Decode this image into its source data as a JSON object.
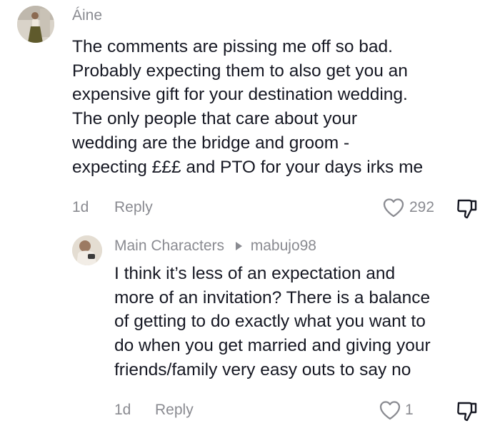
{
  "comment": {
    "username": "Áine",
    "avatar_icon": "user-avatar-photo",
    "lines": [
      "The comments are pissing me off so bad.",
      "Probably expecting them to also get you an",
      "expensive gift for your destination wedding.",
      "The only people that care about your",
      "wedding are the bridge and groom -",
      "expecting £££ and PTO for your days irks me"
    ],
    "timestamp": "1d",
    "reply_label": "Reply",
    "like_icon": "heart-icon",
    "like_count": "292",
    "dislike_icon": "thumbs-down-icon"
  },
  "reply": {
    "username": "Main Characters",
    "reply_to_icon": "play-triangle-icon",
    "reply_to": "mabujo98",
    "avatar_icon": "user-avatar-photo",
    "lines": [
      "I think it’s less of an expectation and",
      "more of an invitation? There is a balance",
      "of getting to do exactly what you want to",
      "do when you get married and giving your",
      "friends/family very easy outs to say no"
    ],
    "timestamp": "1d",
    "reply_label": "Reply",
    "like_icon": "heart-icon",
    "like_count": "1",
    "dislike_icon": "thumbs-down-icon"
  },
  "colors": {
    "text_primary": "#161823",
    "text_secondary": "#8a8b91",
    "background": "#ffffff"
  }
}
